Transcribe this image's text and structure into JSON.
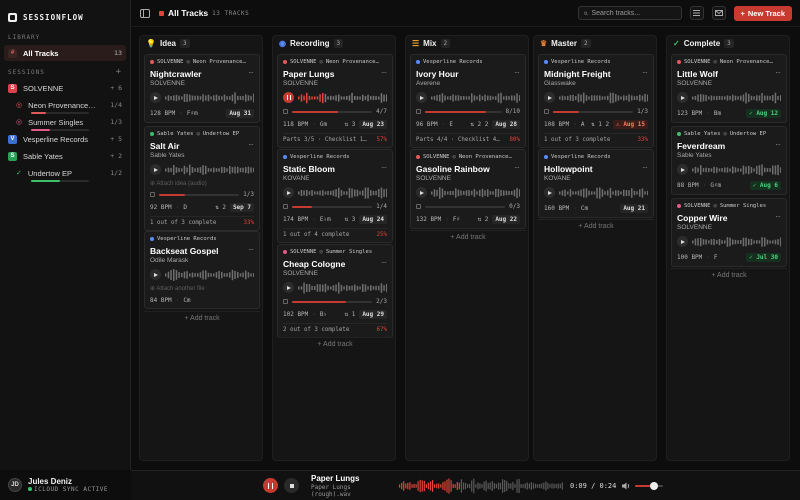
{
  "app": {
    "name": "SESSIONFLOW"
  },
  "sidebar": {
    "library_label": "LIBRARY",
    "sessions_label": "SESSIONS",
    "add_icon": "+",
    "library": [
      {
        "label": "All Tracks",
        "count": "13",
        "initial": "#"
      }
    ],
    "sessions": [
      {
        "initial": "S",
        "label": "SOLVENNE",
        "count": "6",
        "color": "#d9434b",
        "children": [
          {
            "label": "Neon Provenance…",
            "count": "1/4",
            "progress": 0.25,
            "color": "#e05a5a"
          },
          {
            "label": "Summer Singles",
            "count": "1/3",
            "progress": 0.33,
            "color": "#e05a8a"
          }
        ]
      },
      {
        "initial": "V",
        "label": "Vesperline Records",
        "count": "5",
        "color": "#3b6fd6",
        "children": []
      },
      {
        "initial": "S",
        "label": "Sable Yates",
        "count": "2",
        "color": "#2e9e55",
        "children": [
          {
            "label": "Undertow EP",
            "count": "1/2",
            "progress": 0.5,
            "color": "#3fbf6a"
          }
        ]
      }
    ],
    "user": {
      "initials": "JD",
      "name": "Jules Deniz",
      "sync": "ICLOUD SYNC ACTIVE"
    }
  },
  "topbar": {
    "title": "All Tracks",
    "count": "13 TRACKS",
    "search_placeholder": "Search tracks...",
    "new_button": "New Track"
  },
  "columns": [
    {
      "key": "idea",
      "label": "Idea",
      "count": "3",
      "icon": "lightbulb-icon",
      "glyph": "💡",
      "color": "#e0c040",
      "add": "+ Add track"
    },
    {
      "key": "recording",
      "label": "Recording",
      "count": "3",
      "icon": "record-icon",
      "glyph": "◉",
      "color": "#5a8cff",
      "add": "+ Add track"
    },
    {
      "key": "mix",
      "label": "Mix",
      "count": "2",
      "icon": "sliders-icon",
      "glyph": "☰",
      "color": "#e0a030",
      "add": "+ Add track"
    },
    {
      "key": "master",
      "label": "Master",
      "count": "2",
      "icon": "crown-icon",
      "glyph": "♛",
      "color": "#e07a30",
      "add": "+ Add track"
    },
    {
      "key": "complete",
      "label": "Complete",
      "count": "3",
      "icon": "check-circle-icon",
      "glyph": "✓",
      "color": "#3fbf6a",
      "add": "+ Add track"
    }
  ],
  "cards": {
    "idea": [
      {
        "label": "SOLVENNE",
        "sub": "Neon Provenance…",
        "dot": "#e05a5a",
        "title": "Nightcrawler",
        "artist": "SOLVENNE",
        "attach": "",
        "tasks": null,
        "bpm": "128 BPM",
        "key": "F♯m",
        "extra": "",
        "date": "Aug 31",
        "date_style": "",
        "footer": null
      },
      {
        "label": "Sable Yates",
        "sub": "Undertow EP",
        "dot": "#3fbf6a",
        "title": "Salt Air",
        "artist": "Sable Yates",
        "attach": "Attach idea (audio)",
        "tasks": {
          "count": "1/3",
          "progress": 0.33
        },
        "bpm": "92 BPM",
        "key": "D",
        "extra": "2",
        "date": "Sep 7",
        "date_style": "",
        "footer": {
          "text": "1 out of 3 complete",
          "pct": "33%"
        }
      },
      {
        "label": "Vesperline Records",
        "sub": "",
        "dot": "#5a8cff",
        "title": "Backseat Gospel",
        "artist": "Odile Marask",
        "attach": "Attach another file",
        "tasks": null,
        "bpm": "84 BPM",
        "key": "Cm",
        "extra": "",
        "date": "",
        "date_style": "",
        "footer": null
      }
    ],
    "recording": [
      {
        "label": "SOLVENNE",
        "sub": "Neon Provenance…",
        "dot": "#e05a5a",
        "title": "Paper Lungs",
        "artist": "SOLVENNE",
        "playing": true,
        "tasks": {
          "count": "4/7",
          "progress": 0.57
        },
        "bpm": "118 BPM",
        "key": "Gm",
        "extra": "3",
        "date": "Aug 23",
        "date_style": "",
        "footer": {
          "text": "Parts 3/5 · Checklist 1…",
          "pct": "57%"
        }
      },
      {
        "label": "Vesperline Records",
        "sub": "",
        "dot": "#5a8cff",
        "title": "Static Bloom",
        "artist": "KOVANE",
        "tasks": {
          "count": "1/4",
          "progress": 0.25
        },
        "bpm": "174 BPM",
        "key": "E♭m",
        "extra": "3",
        "date": "Aug 24",
        "date_style": "",
        "footer": {
          "text": "1 out of 4 complete",
          "pct": "25%"
        }
      },
      {
        "label": "SOLVENNE",
        "sub": "Summer Singles",
        "dot": "#e05a8a",
        "title": "Cheap Cologne",
        "artist": "SOLVENNE",
        "tasks": {
          "count": "2/3",
          "progress": 0.67
        },
        "bpm": "102 BPM",
        "key": "B♭",
        "extra": "1",
        "date": "Aug 29",
        "date_style": "",
        "footer": {
          "text": "2 out of 3 complete",
          "pct": "67%"
        }
      }
    ],
    "mix": [
      {
        "label": "Vesperline Records",
        "sub": "",
        "dot": "#5a8cff",
        "title": "Ivory Hour",
        "artist": "Averene",
        "tasks": {
          "count": "8/10",
          "progress": 0.8
        },
        "bpm": "96 BPM",
        "key": "E",
        "extra": "2 2",
        "date": "Aug 28",
        "date_style": "",
        "footer": {
          "text": "Parts 4/4 · Checklist 4…",
          "pct": "80%"
        }
      },
      {
        "label": "SOLVENNE",
        "sub": "Neon Provenance…",
        "dot": "#e05a5a",
        "title": "Gasoline Rainbow",
        "artist": "SOLVENNE",
        "tasks": {
          "count": "0/3",
          "progress": 0
        },
        "bpm": "132 BPM",
        "key": "F♯",
        "extra": "2",
        "date": "Aug 22",
        "date_style": "",
        "footer": {
          "text": "",
          "pct": ""
        }
      }
    ],
    "master": [
      {
        "label": "Vesperline Records",
        "sub": "",
        "dot": "#5a8cff",
        "title": "Midnight Freight",
        "artist": "Glasswake",
        "tasks": {
          "count": "1/3",
          "progress": 0.33
        },
        "bpm": "108 BPM",
        "key": "A",
        "extra": "1 2",
        "date": "Aug 15",
        "date_style": "warn",
        "footer": {
          "text": "1 out of 3 complete",
          "pct": "33%"
        }
      },
      {
        "label": "Vesperline Records",
        "sub": "",
        "dot": "#5a8cff",
        "title": "Hollowpoint",
        "artist": "KOVANE",
        "tasks": null,
        "bpm": "160 BPM",
        "key": "Cm",
        "extra": "",
        "date": "Aug 21",
        "date_style": "",
        "footer": null
      }
    ],
    "complete": [
      {
        "label": "SOLVENNE",
        "sub": "Neon Provenance…",
        "dot": "#e05a5a",
        "title": "Little Wolf",
        "artist": "SOLVENNE",
        "bpm": "123 BPM",
        "key": "Bm",
        "date": "Aug 12",
        "date_style": "ok"
      },
      {
        "label": "Sable Yates",
        "sub": "Undertow EP",
        "dot": "#3fbf6a",
        "title": "Feverdream",
        "artist": "Sable Yates",
        "bpm": "88 BPM",
        "key": "G♯m",
        "date": "Aug 6",
        "date_style": "ok"
      },
      {
        "label": "SOLVENNE",
        "sub": "Summer Singles",
        "dot": "#e05a8a",
        "title": "Copper Wire",
        "artist": "SOLVENNE",
        "bpm": "100 BPM",
        "key": "F",
        "date": "Jul 30",
        "date_style": "ok"
      }
    ]
  },
  "player": {
    "title": "Paper Lungs",
    "file": "Paper Lungs (rough).wav",
    "time": "0:09 / 0:24",
    "volume": 0.6
  },
  "colors": {
    "accent": "#c63a2f",
    "bg": "#0d0d0d",
    "panel": "#151515",
    "ok": "#4fd37e",
    "warn": "#ff7b66"
  }
}
